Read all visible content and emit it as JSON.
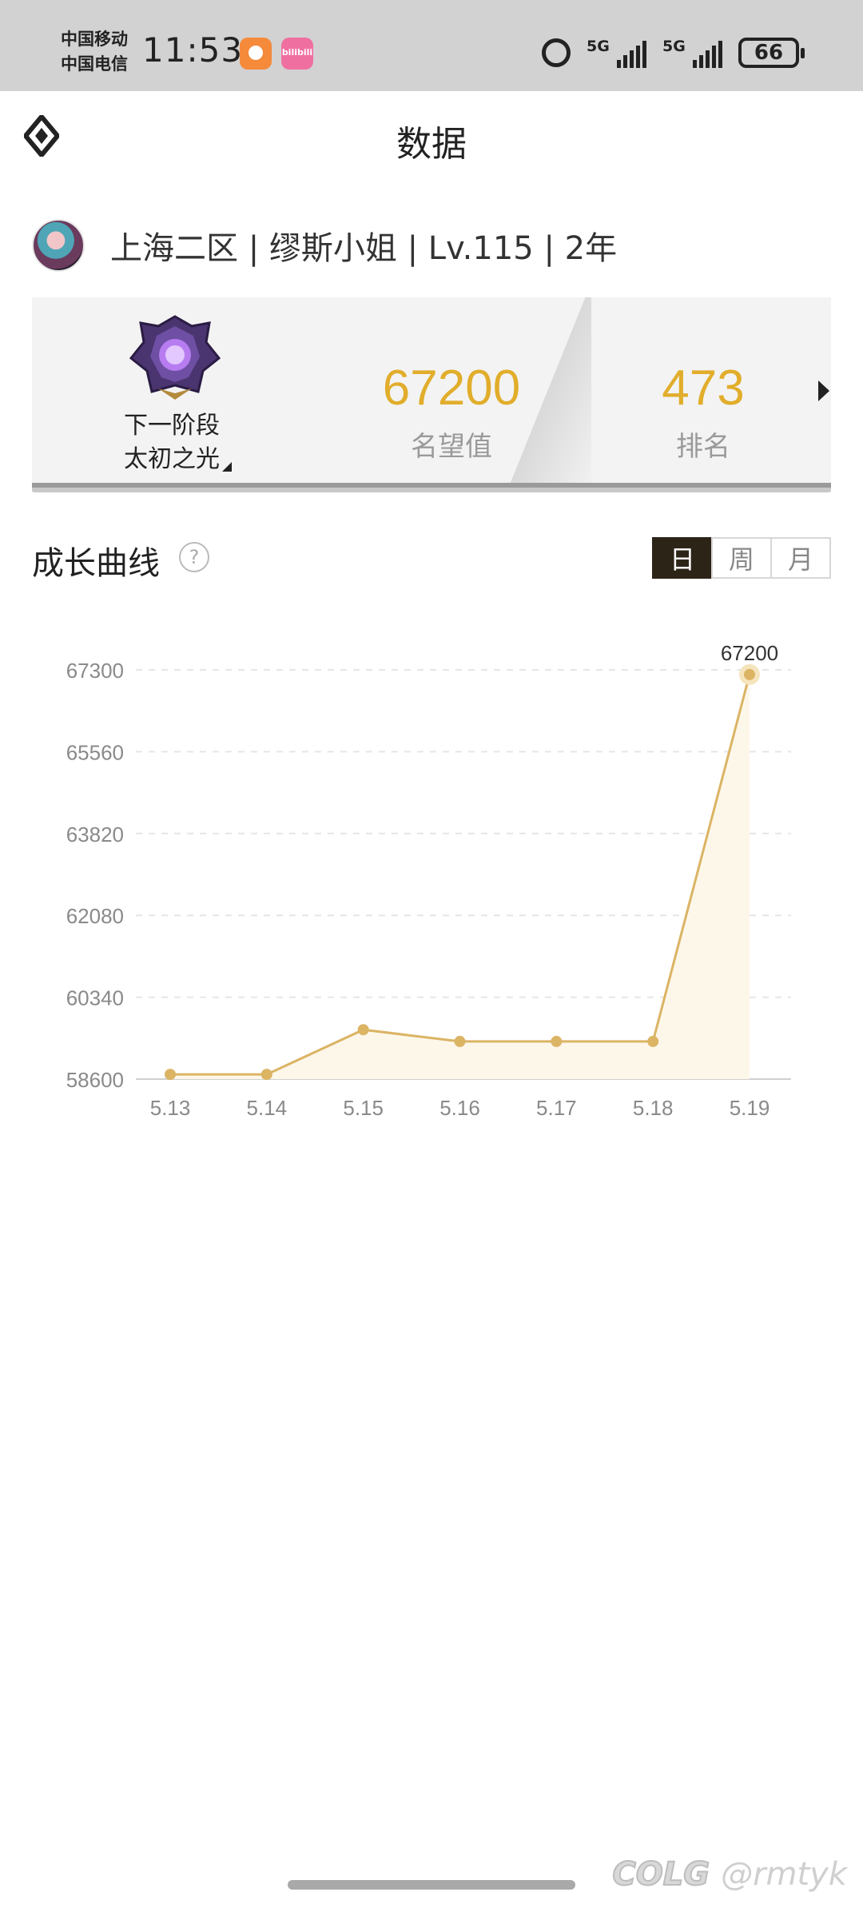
{
  "status_bar": {
    "carrier_1": "中国移动",
    "carrier_2": "中国电信",
    "time": "11:53",
    "app_icon_2_text": "bilibili",
    "network_1": "5G",
    "network_2": "5G",
    "battery": "66"
  },
  "header": {
    "title": "数据"
  },
  "profile": {
    "info": "上海二区 | 缪斯小姐 | Lv.115 | 2年"
  },
  "rank_card": {
    "next_stage_label": "下一阶段",
    "next_stage_name": "太初之光",
    "reputation_value": "67200",
    "reputation_label": "名望值",
    "rank_value": "473",
    "rank_label": "排名"
  },
  "growth": {
    "title": "成长曲线",
    "help": "?",
    "tabs": [
      "日",
      "周",
      "月"
    ],
    "active_tab": "日"
  },
  "chart_data": {
    "type": "area",
    "categories": [
      "5.13",
      "5.14",
      "5.15",
      "5.16",
      "5.17",
      "5.18",
      "5.19"
    ],
    "values": [
      58700,
      58700,
      59650,
      59400,
      59400,
      59400,
      67200
    ],
    "y_ticks": [
      67300,
      65560,
      63820,
      62080,
      60340,
      58600
    ],
    "ylim": [
      58600,
      67300
    ],
    "point_label": "67200",
    "grid": true,
    "line_color": "#dbb464",
    "fill_color": "#fdf7ea"
  },
  "watermark": {
    "brand": "COLG",
    "handle": "@rmtyk"
  },
  "colors": {
    "accent_gold": "#e1ad2b",
    "tab_active_bg": "#2d2418"
  }
}
